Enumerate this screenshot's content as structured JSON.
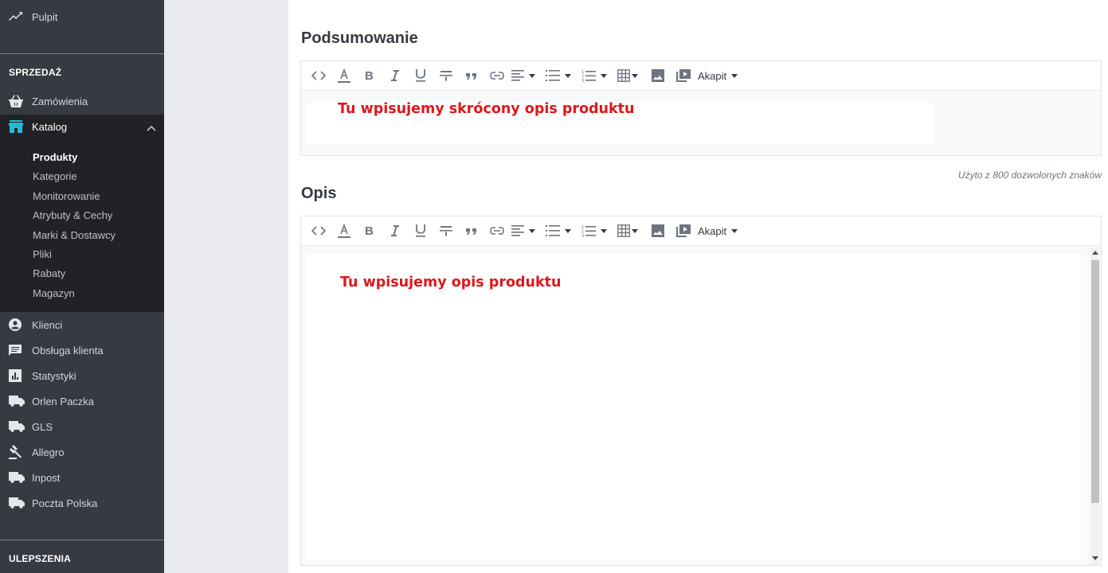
{
  "sidebar": {
    "dashboard": "Pulpit",
    "sales_header": "SPRZEDAŻ",
    "orders": "Zamówienia",
    "catalog": "Katalog",
    "catalog_items": [
      "Produkty",
      "Kategorie",
      "Monitorowanie",
      "Atrybuty & Cechy",
      "Marki & Dostawcy",
      "Pliki",
      "Rabaty",
      "Magazyn"
    ],
    "customers": "Klienci",
    "customer_service": "Obsługa klienta",
    "stats": "Statystyki",
    "orlen": "Orlen Paczka",
    "gls": "GLS",
    "allegro": "Allegro",
    "inpost": "Inpost",
    "poczta": "Poczta Polska",
    "upgrades_header": "ULEPSZENIA"
  },
  "summary": {
    "title": "Podsumowanie",
    "content": "Tu wpisujemy skrócony opis produktu",
    "hint": "Użyto z 800 dozwolonych znaków"
  },
  "description": {
    "title": "Opis",
    "content": "Tu wpisujemy opis produktu"
  },
  "toolbar": {
    "paragraph_label": "Akapit"
  },
  "colors": {
    "sidebar_bg": "#363a41",
    "sidebar_active_bg": "#202226",
    "accent": "#25b9d7",
    "annotation_red": "#e0161b"
  }
}
